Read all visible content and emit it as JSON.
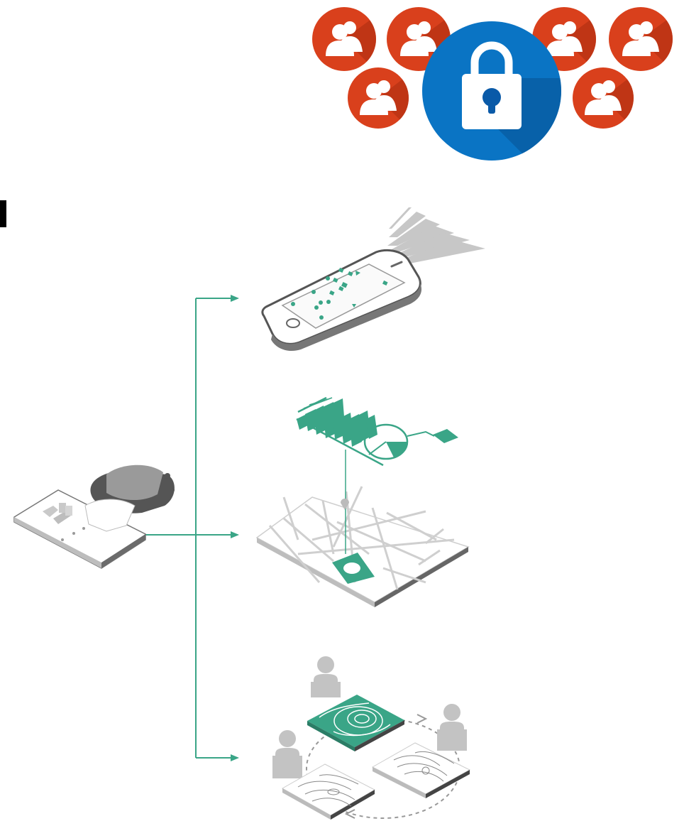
{
  "colors": {
    "user_badge": "#d9401c",
    "user_badge_shadow": "#a92c10",
    "lock_badge": "#0a74c4",
    "lock_badge_shadow": "#075a9e",
    "teal": "#3aa587",
    "grey_dark": "#555555",
    "grey_mid": "#9a9a9a",
    "grey_light": "#cfcfcf"
  },
  "icons": {
    "top": [
      "user-group-icon",
      "user-group-icon",
      "padlock-icon",
      "user-group-icon",
      "user-group-icon"
    ],
    "bottom": [
      "user-group-icon",
      "user-group-icon"
    ]
  },
  "diagram": {
    "source": "building-with-people-illustration",
    "targets": [
      "smartphone-map-illustration",
      "city-map-analytics-illustration",
      "shared-topographic-maps-illustration"
    ]
  }
}
